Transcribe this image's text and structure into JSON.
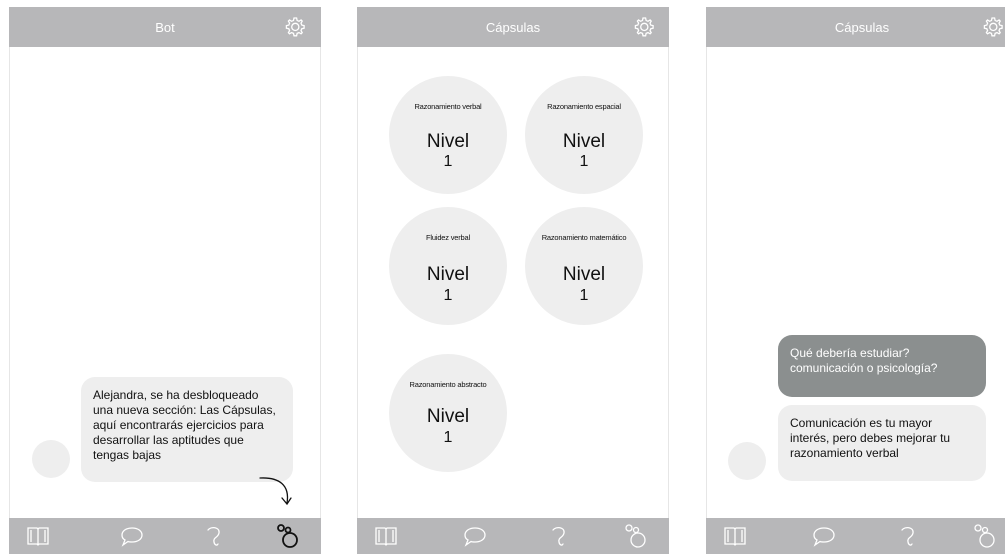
{
  "colors": {
    "bar": "#b7b7b9",
    "bubble_bot": "#eeeeee",
    "bubble_user": "#8b8f8f",
    "circle": "#eeeeee"
  },
  "screens": [
    {
      "title": "Bot",
      "settings_icon": "gear-icon",
      "messages": [
        {
          "from": "bot",
          "text": "Alejandra, se ha desbloqueado una nueva sección: Las Cápsulas, aquí encontrarás ejercicios para desarrollar las aptitudes que tengas bajas"
        }
      ],
      "nav": [
        "book-icon",
        "chat-bubble-icon",
        "hook-icon",
        "capsules-icon"
      ],
      "active_nav": "capsules-icon"
    },
    {
      "title": "Cápsulas",
      "settings_icon": "gear-icon",
      "capsules": [
        {
          "name": "Razonamiento verbal",
          "level_label": "Nivel",
          "level": "1"
        },
        {
          "name": "Razonamiento espacial",
          "level_label": "Nivel",
          "level": "1"
        },
        {
          "name": "Fluidez verbal",
          "level_label": "Nivel",
          "level": "1"
        },
        {
          "name": "Razonamiento matemático",
          "level_label": "Nivel",
          "level": "1"
        },
        {
          "name": "Razonamiento abstracto",
          "level_label": "Nivel",
          "level": "1"
        }
      ],
      "nav": [
        "book-icon",
        "chat-bubble-icon",
        "hook-icon",
        "capsules-icon"
      ]
    },
    {
      "title": "Cápsulas",
      "settings_icon": "gear-icon",
      "messages": [
        {
          "from": "user",
          "text": "Qué debería estudiar? comunicación o psicología?"
        },
        {
          "from": "bot",
          "text": "Comunicación es tu mayor interés, pero debes mejorar tu razonamiento verbal"
        }
      ],
      "nav": [
        "book-icon",
        "chat-bubble-icon",
        "hook-icon",
        "capsules-icon"
      ]
    }
  ]
}
